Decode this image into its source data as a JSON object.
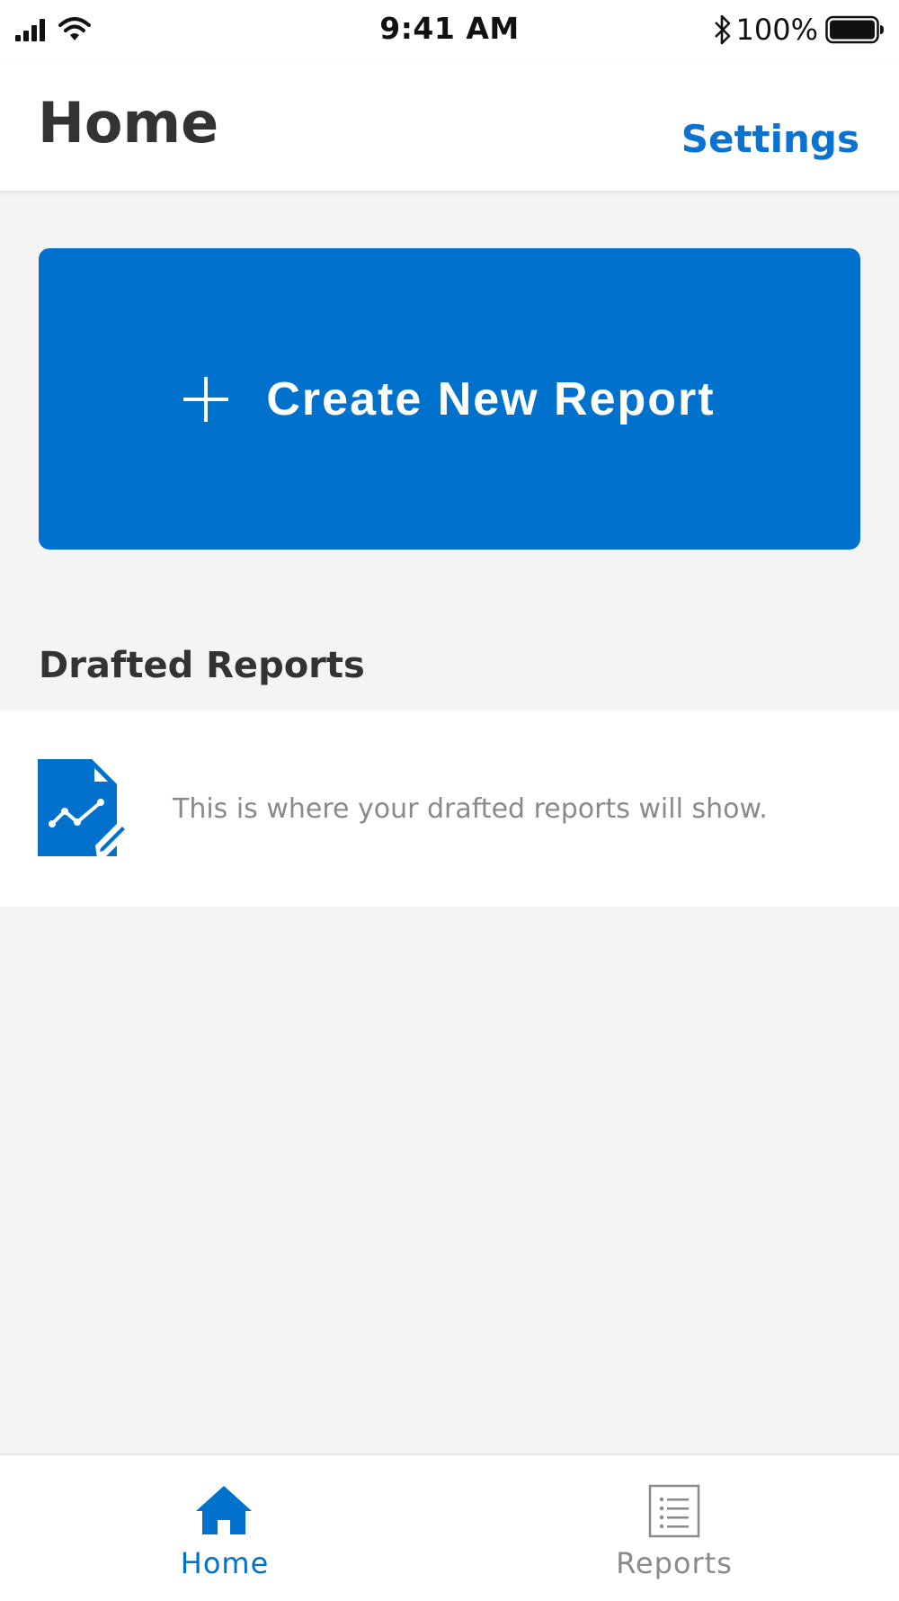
{
  "status_bar": {
    "time": "9:41 AM",
    "battery_percent": "100%",
    "icons": [
      "cellular-signal-icon",
      "wifi-icon",
      "bluetooth-icon",
      "battery-icon"
    ]
  },
  "header": {
    "title": "Home",
    "settings_label": "Settings"
  },
  "create_button": {
    "label": "Create New Report",
    "icon": "plus-icon"
  },
  "drafted_reports": {
    "title": "Drafted Reports",
    "empty_message": "This is where your drafted reports will show.",
    "icon": "report-edit-icon"
  },
  "tab_bar": {
    "tabs": [
      {
        "label": "Home",
        "icon": "home-icon",
        "active": true
      },
      {
        "label": "Reports",
        "icon": "list-document-icon",
        "active": false
      }
    ]
  },
  "colors": {
    "accent": "#0171ce",
    "link": "#0a72d0",
    "background": "#f4f4f4",
    "inactive_tab": "#8a8a8a"
  }
}
